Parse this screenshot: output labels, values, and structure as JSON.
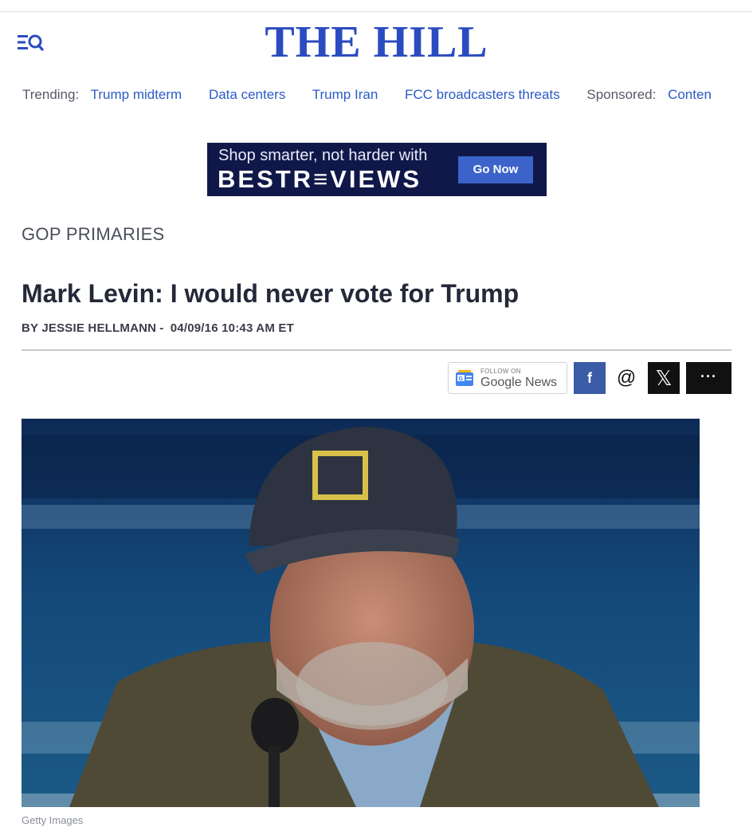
{
  "header": {
    "logo": "THE HILL",
    "menu_icon": "menu-search-icon"
  },
  "trending": {
    "label": "Trending:",
    "links": [
      "Trump midterm",
      "Data centers",
      "Trump Iran",
      "FCC broadcasters threats"
    ],
    "sponsored_label": "Sponsored:",
    "sponsored_link": "Conten"
  },
  "ad": {
    "line1": "Shop smarter, not harder with",
    "brand": "BESTR≡VIEWS",
    "cta": "Go Now"
  },
  "article": {
    "section": "GOP PRIMARIES",
    "headline": "Mark Levin: I would never vote for Trump",
    "byline_author": "BY JESSIE HELLMANN",
    "byline_sep": "-",
    "byline_date": "04/09/16 10:43 AM ET",
    "photo_credit": "Getty Images"
  },
  "share": {
    "gnews_follow": "FOLLOW ON",
    "gnews_name": "Google News",
    "facebook": "f",
    "threads": "@",
    "x": "𝕏",
    "more": "···"
  },
  "colors": {
    "brand_blue": "#2b4cc0",
    "link_blue": "#2b5ac6",
    "ad_navy": "#10184a",
    "facebook_blue": "#3a5ba5"
  }
}
